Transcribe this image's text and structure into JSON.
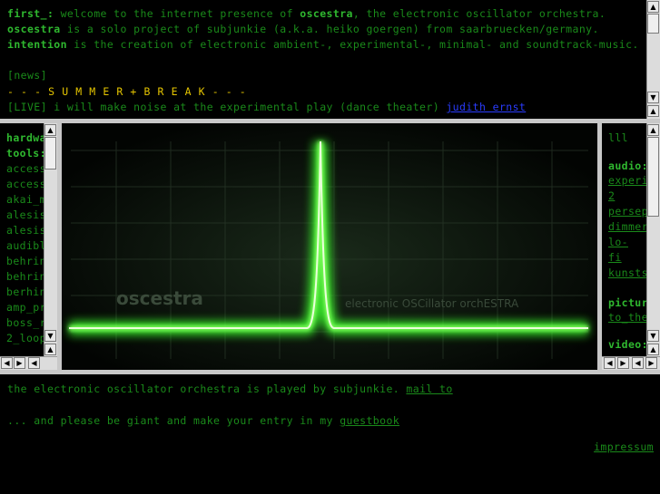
{
  "top": {
    "line1_label": "first_:",
    "line1_text": " welcome to the internet presence of ",
    "line1_brand": "oscestra",
    "line1_rest": ", the electronic oscillator orchestra.",
    "line2_label": "oscestra",
    "line2_text": " is a solo project of subjunkie (a.k.a. heiko goergen) from saarbruecken/germany.",
    "line3_label": "intention",
    "line3_text": " is the creation of electronic ambient-, experimental-, minimal- and soundtrack-music.",
    "news_label": "[news]",
    "break_text": "- - - S U M M E R + B R E A K - - -",
    "live_text": "[LIVE] i will make noise at the experimental play (dance theater) ",
    "live_link": "judith ernst"
  },
  "left": {
    "heading1": "hardware",
    "heading2": "tools:",
    "items": [
      "access",
      "access",
      "akai_m",
      "alesis",
      "alesis",
      "audibl",
      "behrin",
      "behrin",
      "berhin",
      "amp_pr",
      "boss_r",
      "2_loop"
    ]
  },
  "scope": {
    "brand_text": "oscestra",
    "sub_text": "electronic OSCillator orchESTRA"
  },
  "right": {
    "top_text": "lll",
    "audio_label": "audio:",
    "audio_items": [
      "experi",
      "2",
      "persep",
      "dimmer",
      "lo-",
      "fi",
      "kunsts"
    ],
    "pictures_label": "pictur",
    "pictures_item": "to_the",
    "video_label": "video:"
  },
  "bottom": {
    "line1_text": "the electronic oscillator orchestra is played by subjunkie. ",
    "line1_link": "mail to",
    "line2_text": "... and please be giant and make your entry in my ",
    "line2_link": "guestbook",
    "impressum": "impressum"
  },
  "colors": {
    "background": "#000000",
    "text": "#1a8a1a",
    "accent": "#e4c400",
    "link": "#2a3cff",
    "scope_green": "#7bff5a"
  },
  "icons": [
    "arrow-up-icon",
    "arrow-down-icon",
    "arrow-left-icon",
    "arrow-right-icon"
  ]
}
